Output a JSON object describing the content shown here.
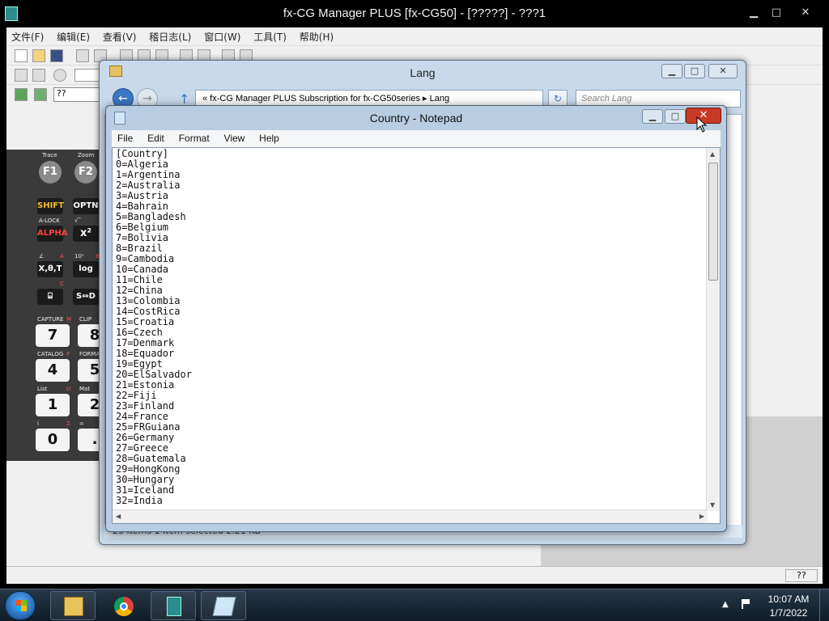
{
  "app": {
    "title": "fx-CG Manager PLUS [fx-CG50] - [?????] - ???1",
    "caption_min": "▁",
    "caption_max": "□",
    "caption_close": "✕",
    "menu": [
      "文件(F)",
      "编辑(E)",
      "查看(V)",
      "稽日志(L)",
      "窗口(W)",
      "工具(T)",
      "帮助(H)"
    ],
    "combo_value": "??",
    "status_right": "??",
    "calculator": {
      "function_keys": [
        "F1",
        "F2"
      ],
      "function_labels": [
        "Trace",
        "Zoom"
      ],
      "keys": [
        "SHIFT",
        "OPTN",
        "ALPHA",
        "x²",
        "X,θ,T",
        "log",
        "⌸",
        "S⇔D"
      ],
      "key_labels": [
        "A-LOCK",
        "√‾",
        "∠",
        "A",
        "10ˣ",
        "B",
        "C"
      ],
      "number_keys": [
        "7",
        "4",
        "1",
        "0",
        "8",
        "5",
        "2",
        "."
      ],
      "number_labels": [
        "CAPTURE",
        "M",
        "CLIP",
        "CATALOG",
        "P",
        "FORMAT",
        "List",
        "U",
        "Mat",
        "i",
        "Z",
        "="
      ]
    }
  },
  "explorer": {
    "title": "Lang",
    "breadcrumb": "«   fx-CG Manager PLUS Subscription for fx-CG50series  ▸  Lang",
    "search_placeholder": "Search Lang",
    "status": "25 items      1 item selected  2.21 KB"
  },
  "notepad": {
    "title": "Country - Notepad",
    "menu": [
      "File",
      "Edit",
      "Format",
      "View",
      "Help"
    ],
    "close": "✕",
    "lines": [
      "[Country]",
      "0=Algeria",
      "1=Argentina",
      "2=Australia",
      "3=Austria",
      "4=Bahrain",
      "5=Bangladesh",
      "6=Belgium",
      "7=Bolivia",
      "8=Brazil",
      "9=Cambodia",
      "10=Canada",
      "11=Chile",
      "12=China",
      "13=Colombia",
      "14=CostRica",
      "15=Croatia",
      "16=Czech",
      "17=Denmark",
      "18=Equador",
      "19=Egypt",
      "20=ElSalvador",
      "21=Estonia",
      "22=Fiji",
      "23=Finland",
      "24=France",
      "25=FRGuiana",
      "26=Germany",
      "27=Greece",
      "28=Guatemala",
      "29=HongKong",
      "30=Hungary",
      "31=Iceland",
      "32=India"
    ]
  },
  "taskbar": {
    "apps": [
      "explorer-icon",
      "chrome-icon",
      "calculator-icon",
      "notepad-icon"
    ],
    "time": "10:07 AM",
    "date": "1/7/2022"
  }
}
